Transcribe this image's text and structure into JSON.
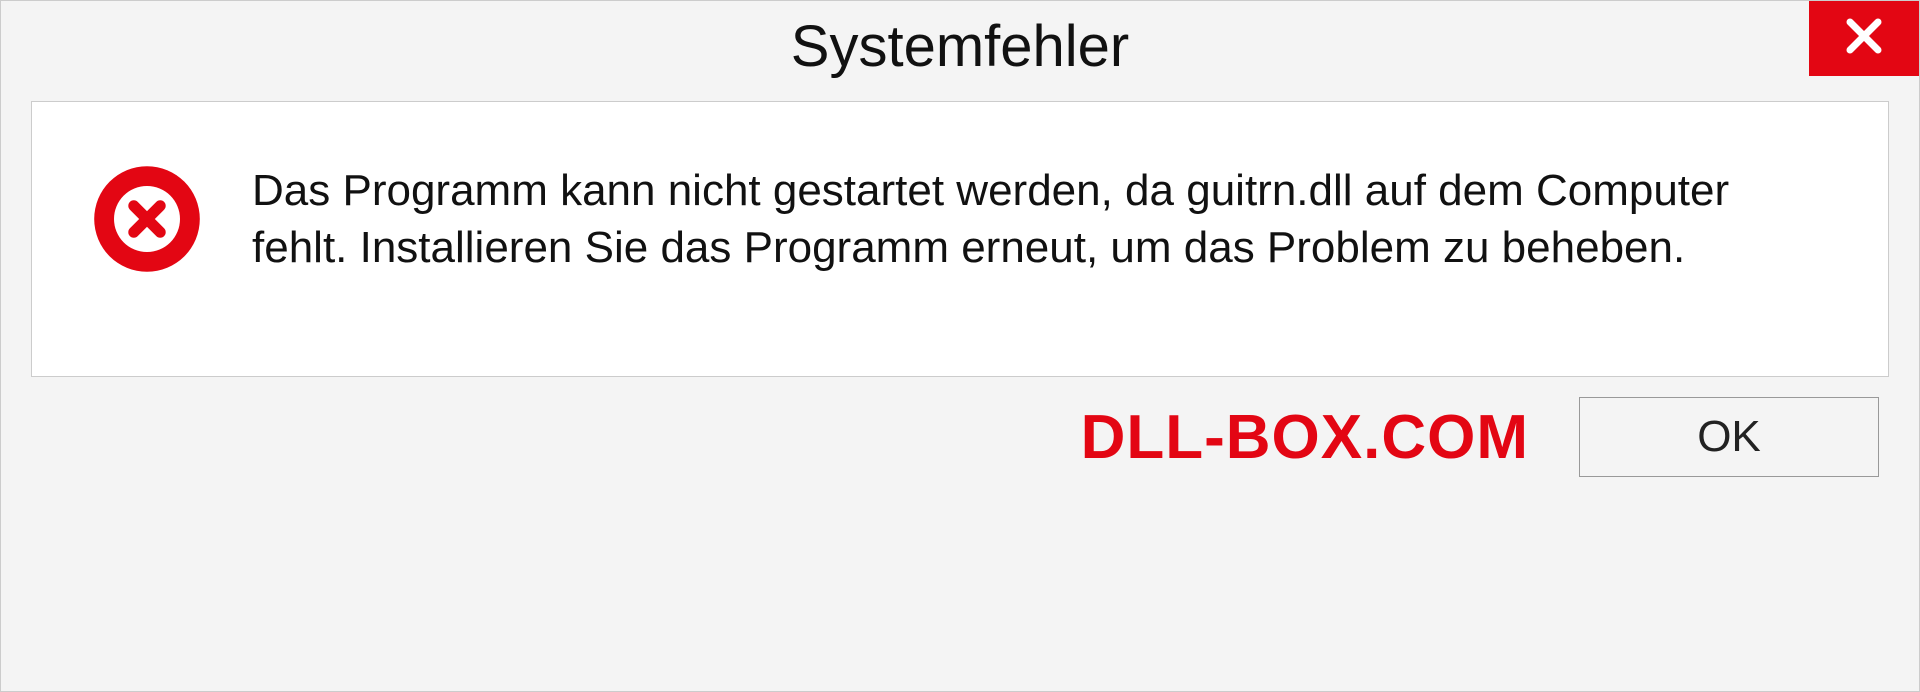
{
  "dialog": {
    "title": "Systemfehler",
    "message": "Das Programm kann nicht gestartet werden, da guitrn.dll auf dem Computer fehlt. Installieren Sie das Programm erneut, um das Problem zu beheben.",
    "ok_label": "OK"
  },
  "watermark": "DLL-BOX.COM",
  "colors": {
    "accent_red": "#e30613"
  }
}
